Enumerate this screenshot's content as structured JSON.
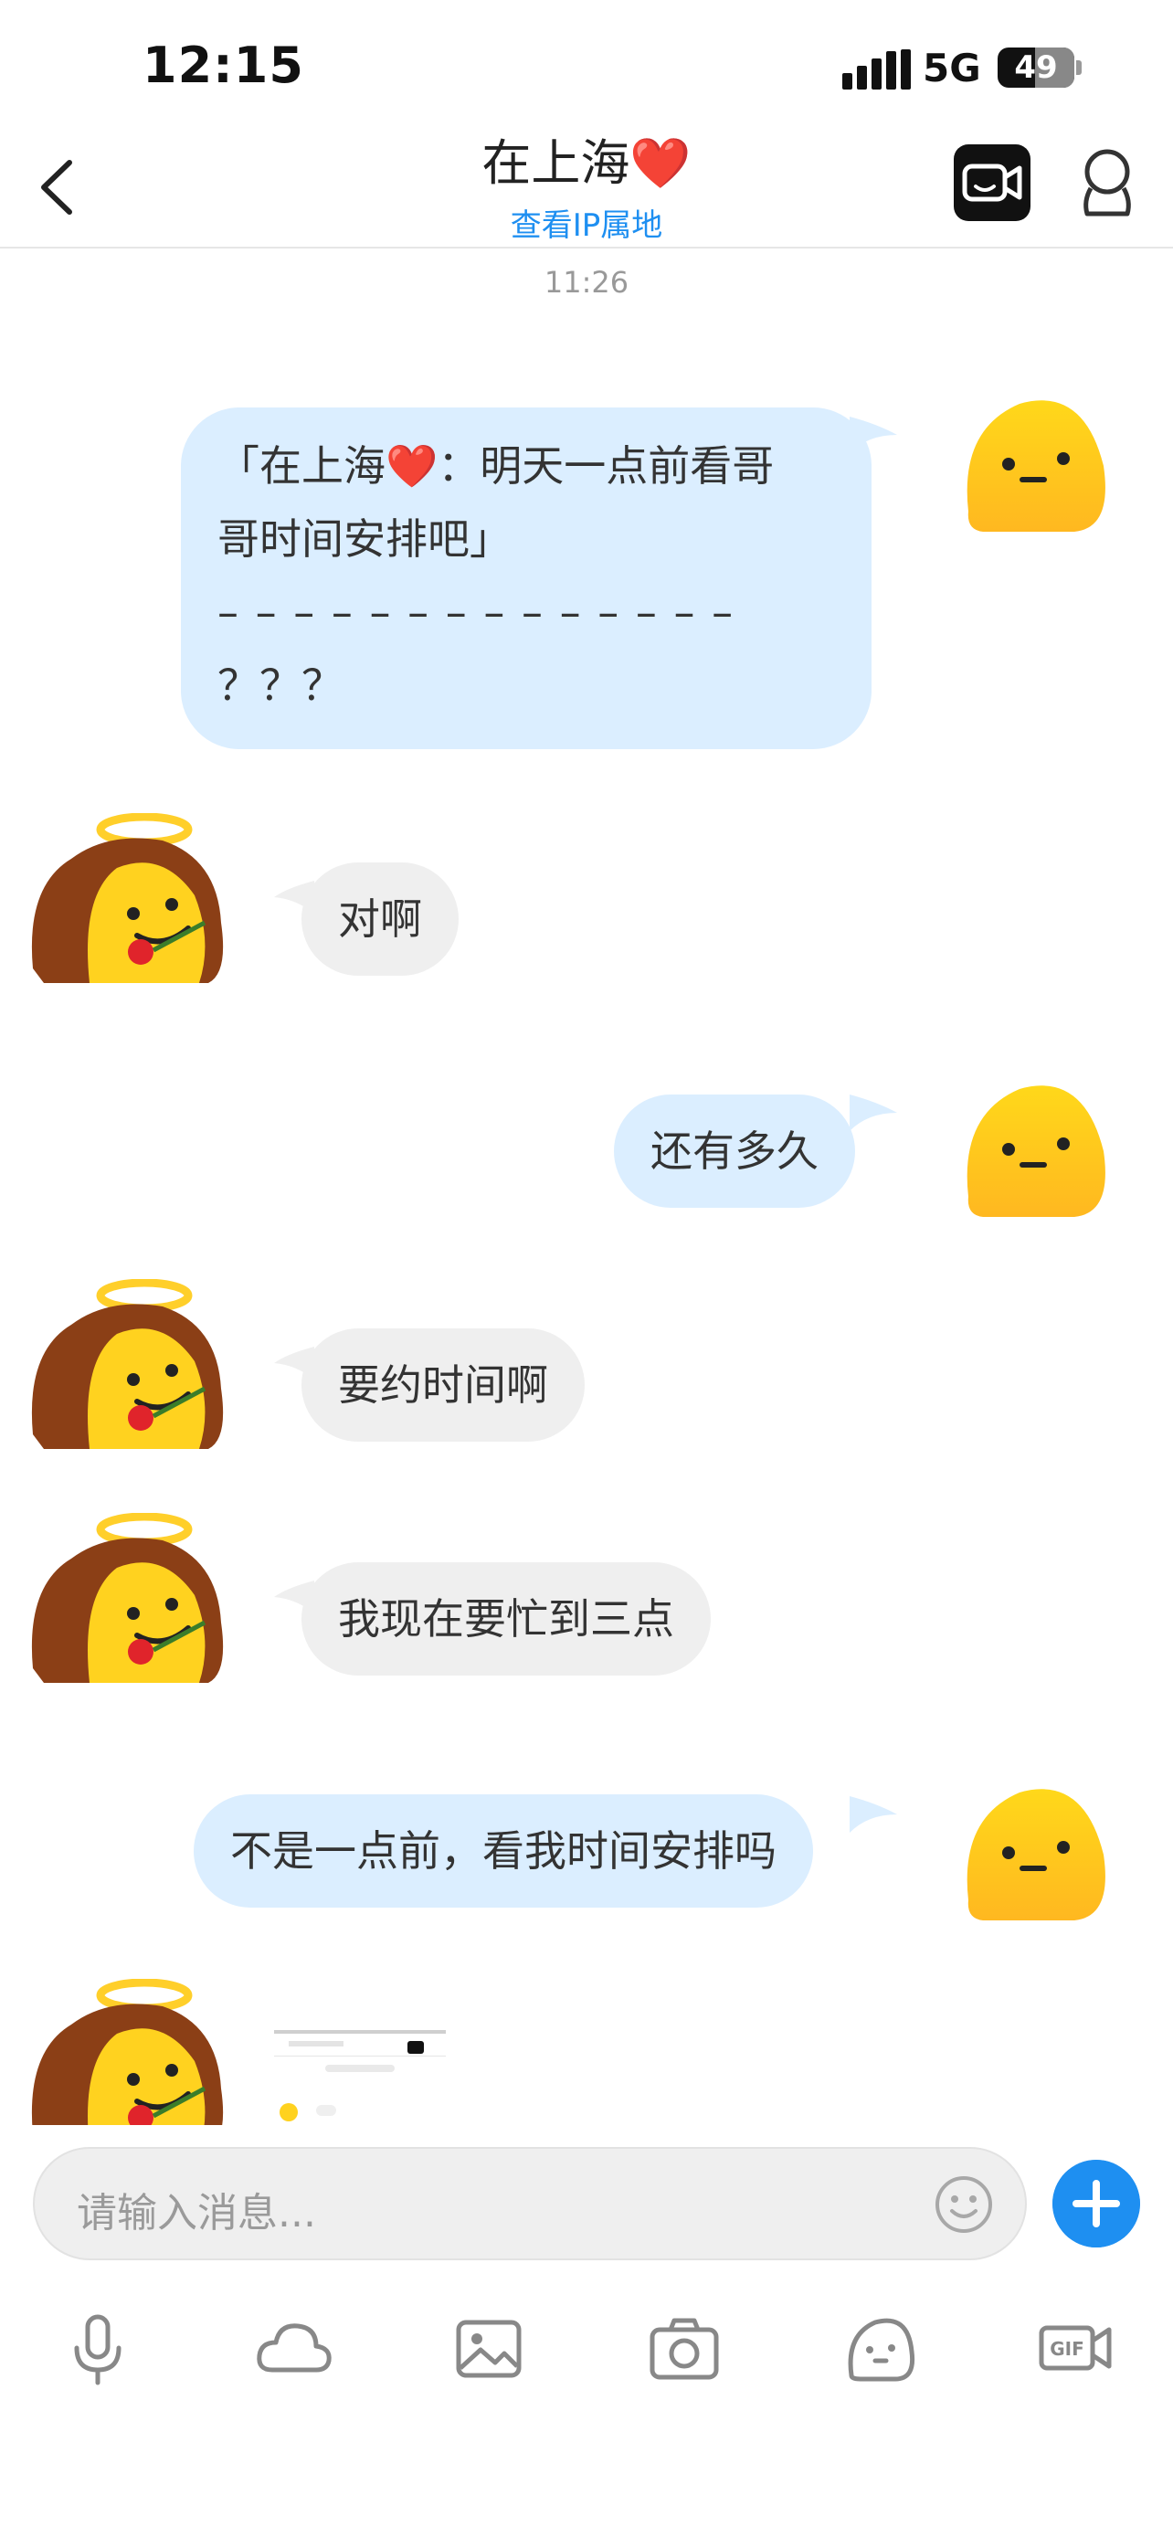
{
  "status": {
    "time": "12:15",
    "network": "5G",
    "battery": "49",
    "battery_level_percent": 49
  },
  "header": {
    "title": "在上海❤️",
    "subtitle": "查看IP属地",
    "icons": [
      "chevron-left-icon",
      "video-call-icon",
      "profile-icon"
    ]
  },
  "chat": {
    "timestamp": "11:26",
    "messages": [
      {
        "sender": "self",
        "lines": [
          "「在上海❤️：明天一点前看哥",
          "哥时间安排吧」",
          "– – – – – – – – – – – – – –",
          "？？？"
        ]
      },
      {
        "sender": "other",
        "text": "对啊"
      },
      {
        "sender": "self",
        "text": "还有多久"
      },
      {
        "sender": "other",
        "text": "要约时间啊"
      },
      {
        "sender": "other",
        "text": "我现在要忙到三点"
      },
      {
        "sender": "self",
        "text": "不是一点前，看我时间安排吗"
      },
      {
        "sender": "other",
        "type": "image",
        "text": ""
      }
    ]
  },
  "input": {
    "placeholder": "请输入消息...",
    "emoji_icon": "smiley-icon",
    "plus_icon": "plus-icon"
  },
  "toolbar": {
    "items": [
      "microphone-icon",
      "cloud-icon",
      "image-icon",
      "camera-icon",
      "sticker-face-icon",
      "gif-icon"
    ]
  },
  "colors": {
    "accent": "#1e8ff1",
    "self_bubble": "#dbeeff",
    "other_bubble": "#efefef",
    "avatar_yellow": "#ffd21f"
  }
}
